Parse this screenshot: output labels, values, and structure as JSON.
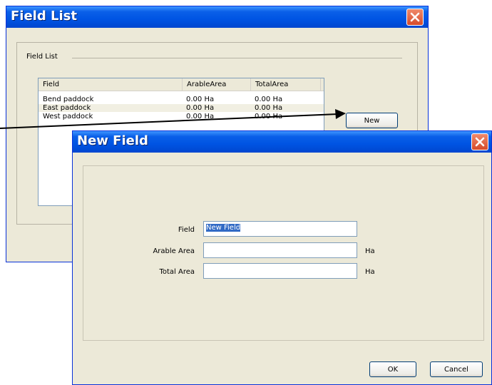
{
  "field_list_window": {
    "title": "Field List",
    "group_label": "Field List",
    "columns": [
      "Field",
      "ArableArea",
      "TotalArea"
    ],
    "rows": [
      {
        "field": "Bend paddock",
        "arable": "0.00 Ha",
        "total": "0.00 Ha"
      },
      {
        "field": "East paddock",
        "arable": "0.00 Ha",
        "total": "0.00 Ha"
      },
      {
        "field": "West paddock",
        "arable": "0.00 Ha",
        "total": "0.00 Ha"
      }
    ],
    "new_button": "New"
  },
  "new_field_window": {
    "title": "New Field",
    "field_label": "Field",
    "field_value": "New Field",
    "arable_label": "Arable Area",
    "arable_value": "",
    "arable_unit": "Ha",
    "total_label": "Total Area",
    "total_value": "",
    "total_unit": "Ha",
    "ok_button": "OK",
    "cancel_button": "Cancel"
  },
  "colors": {
    "titlebar": "#0054E3",
    "window_bg": "#ECE9D8",
    "close_button": "#D64B2B",
    "selection": "#316AC5"
  },
  "icons": [
    "close-icon",
    "arrow-annotation"
  ]
}
